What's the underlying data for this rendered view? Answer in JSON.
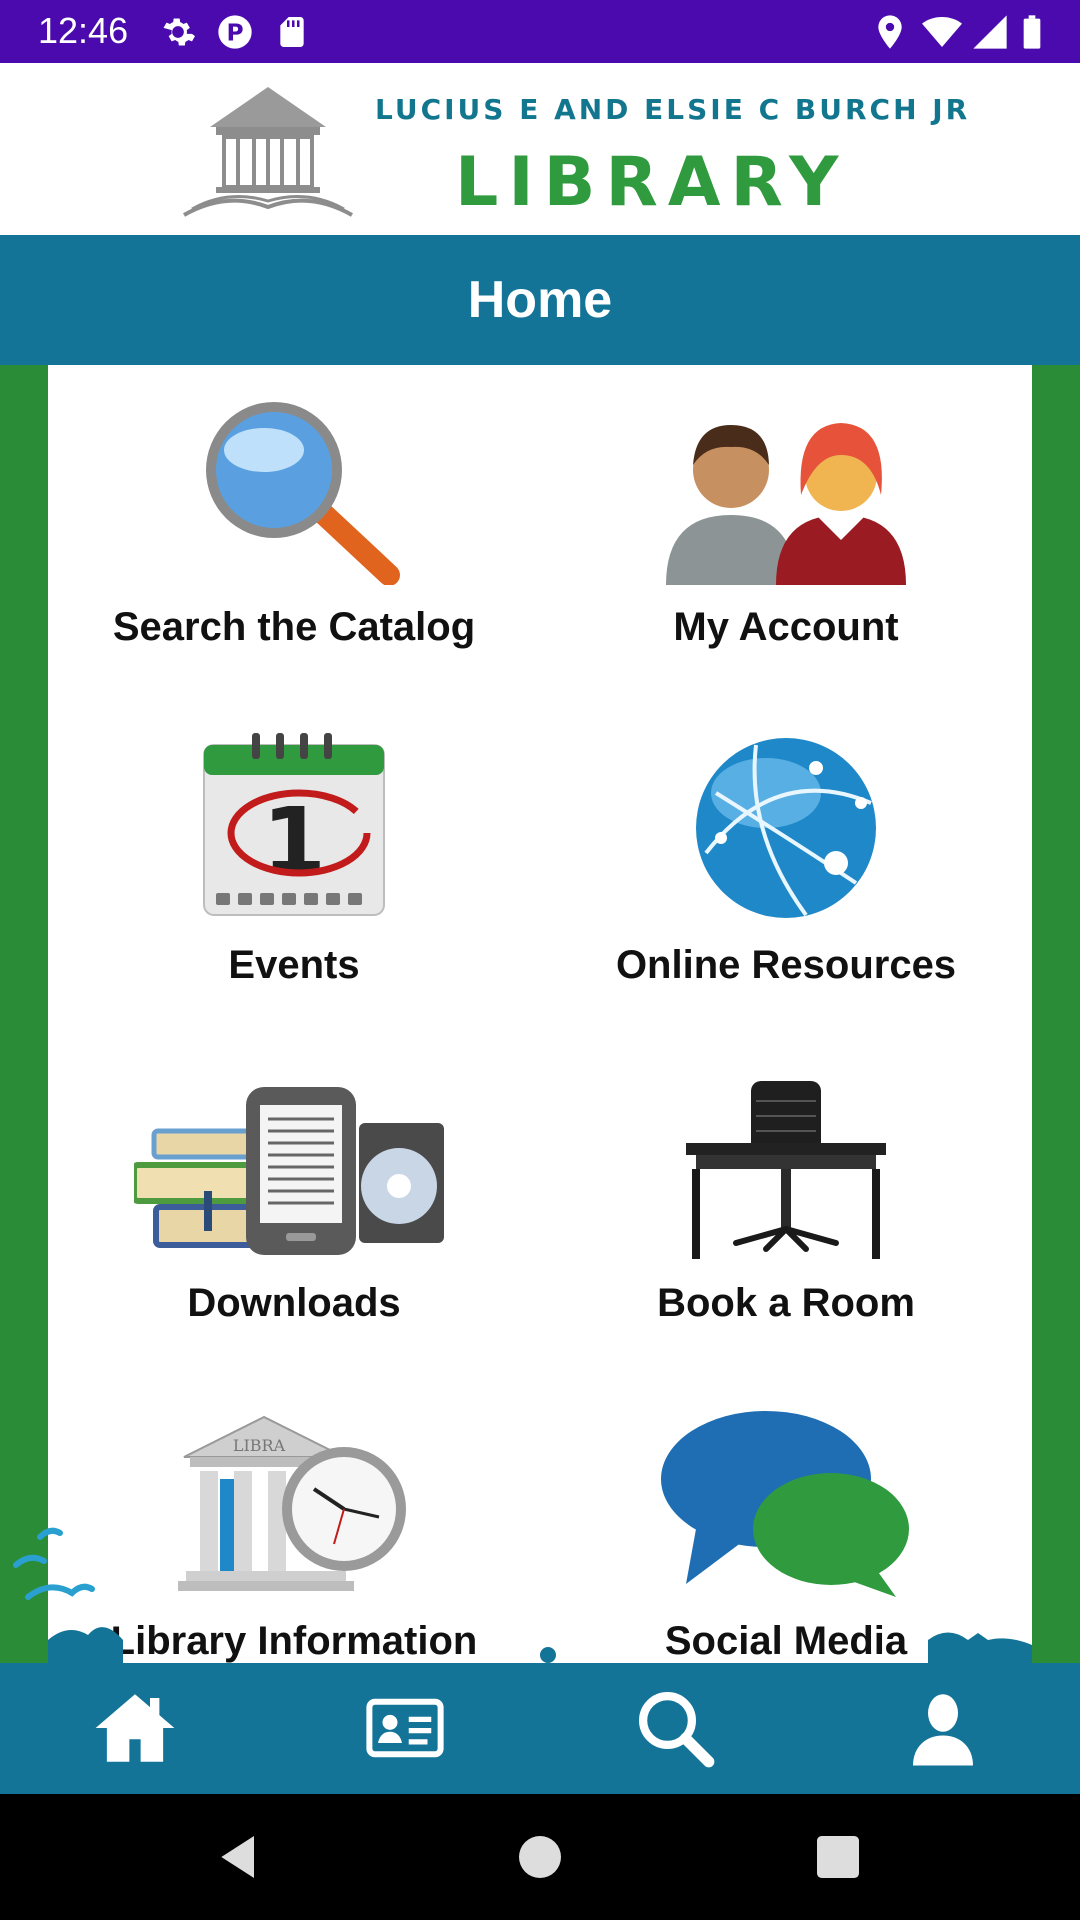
{
  "status_bar": {
    "time": "12:46",
    "background": "#4a0aad"
  },
  "header": {
    "logo_line1": "LUCIUS E AND ELSIE C BURCH JR",
    "logo_line2": "LIBRARY",
    "logo_line1_color": "#13768f",
    "logo_line2_color": "#2f9a3e"
  },
  "title_bar": {
    "title": "Home",
    "background": "#137498"
  },
  "tiles": [
    {
      "label": "Search the Catalog",
      "icon": "magnifier-icon"
    },
    {
      "label": "My Account",
      "icon": "people-icon"
    },
    {
      "label": "Events",
      "icon": "calendar-icon"
    },
    {
      "label": "Online Resources",
      "icon": "globe-icon"
    },
    {
      "label": "Downloads",
      "icon": "books-ereader-cd-icon"
    },
    {
      "label": "Book a Room",
      "icon": "desk-chair-icon"
    },
    {
      "label": "Library Information",
      "icon": "library-clock-icon"
    },
    {
      "label": "Social Media",
      "icon": "speech-bubbles-icon"
    }
  ],
  "bottom_nav": [
    {
      "name": "home",
      "icon": "home-icon"
    },
    {
      "name": "library-card",
      "icon": "id-card-icon"
    },
    {
      "name": "search",
      "icon": "search-icon"
    },
    {
      "name": "account",
      "icon": "user-icon"
    }
  ],
  "system_nav": [
    "back-icon",
    "home-circle-icon",
    "recents-icon"
  ],
  "colors": {
    "accent": "#137498",
    "side_green": "#2b8c37"
  }
}
